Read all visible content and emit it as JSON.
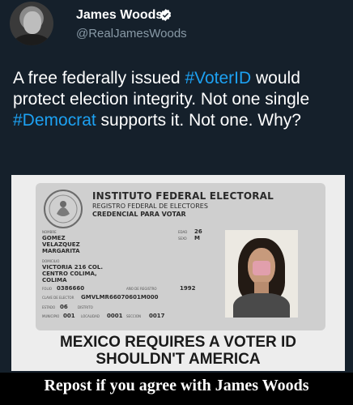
{
  "author": {
    "display_name": "James Woods",
    "handle": "@RealJamesWoods",
    "verified_icon": "verified-badge-icon"
  },
  "tweet": {
    "segments": [
      "A free federally issued ",
      "#VoterID",
      " would protect election integrity. Not one single ",
      "#Democrat",
      " supports it. Not one. Why?"
    ]
  },
  "id_card": {
    "title": "INSTITUTO FEDERAL ELECTORAL",
    "subtitle1": "REGISTRO FEDERAL DE ELECTORES",
    "subtitle2": "CREDENCIAL PARA VOTAR",
    "nombre_label": "NOMBRE",
    "nombre_value": "GOMEZ VELAZQUEZ MARGARITA",
    "edad_label": "EDAD",
    "edad_value": "26",
    "sexo_label": "SEXO",
    "sexo_value": "M",
    "domicilio_label": "DOMICILIO",
    "domicilio_value": "VICTORIA 216 COL. CENTRO COLIMA, COLIMA",
    "folio_label": "FOLIO",
    "folio_value": "0386660",
    "registro_label": "AÑO DE REGISTRO",
    "registro_value": "1992",
    "clave_label": "CLAVE DE ELECTOR",
    "clave_value": "GMVLMR66070601M000",
    "estado_label": "ESTADO",
    "estado_value": "06",
    "distrito_label": "DISTRITO",
    "distrito_value": "",
    "municipio_label": "MUNICIPIO",
    "municipio_value": "001",
    "localidad_label": "LOCALIDAD",
    "localidad_value": "0001",
    "seccion_label": "SECCION",
    "seccion_value": "0017"
  },
  "media_caption": {
    "line1": "MEXICO REQUIRES A VOTER ID",
    "line2": "SHOULDN'T AMERICA"
  },
  "banner": {
    "text": "Repost if you agree with James Woods"
  },
  "colors": {
    "background": "#15202b",
    "hashtag": "#1da1f2",
    "handle": "#8899a6",
    "verified": "#ffffff"
  }
}
